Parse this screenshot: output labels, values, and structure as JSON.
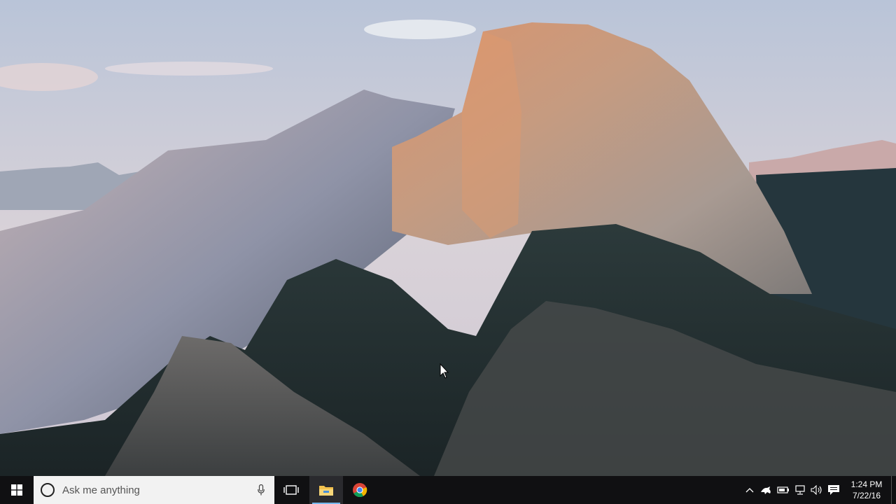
{
  "desktop": {
    "wallpaper": "mountain-landscape-wallpaper"
  },
  "taskbar": {
    "search": {
      "placeholder": "Ask me anything"
    },
    "pinned": [
      {
        "name": "File Explorer",
        "icon": "folder-icon",
        "active": true
      },
      {
        "name": "Google Chrome",
        "icon": "chrome-icon",
        "active": false
      }
    ],
    "tray": {
      "icons": [
        "chevron-up-icon",
        "app-tray-icon",
        "battery-icon",
        "network-icon",
        "volume-icon",
        "action-center-icon"
      ]
    },
    "clock": {
      "time": "1:24 PM",
      "date": "7/22/16"
    }
  },
  "colors": {
    "taskbar_bg": "#101012",
    "search_bg": "#f2f2f2",
    "active_indicator": "#76b9ed",
    "windows_logo": "#ffffff"
  }
}
